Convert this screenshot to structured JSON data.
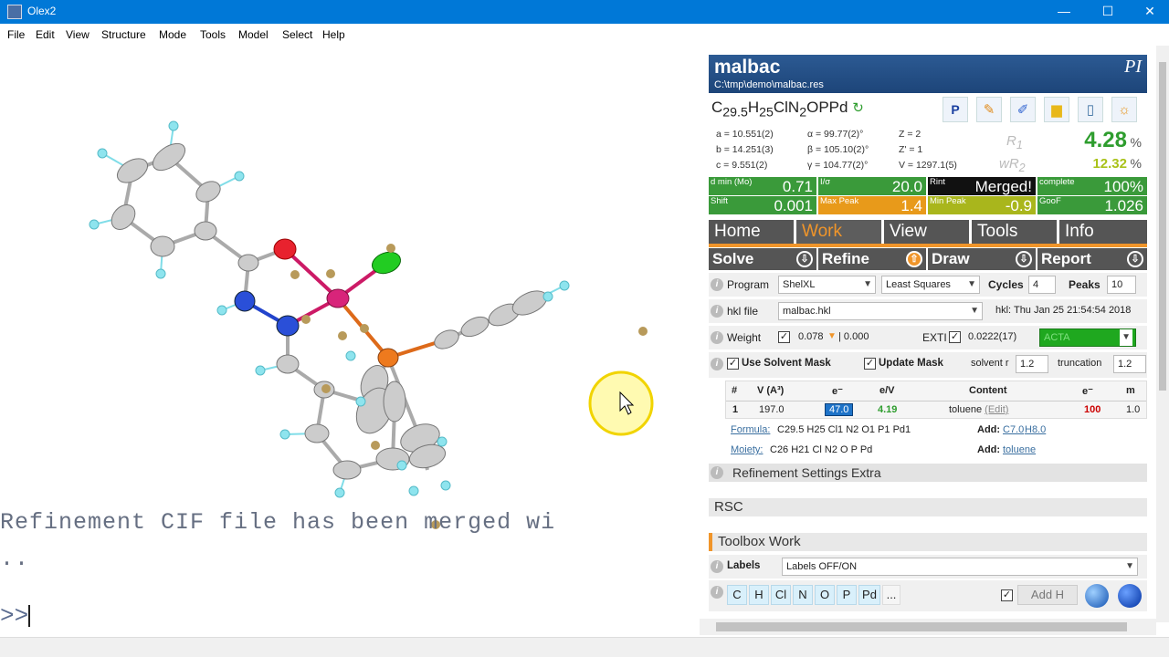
{
  "window": {
    "title": "Olex2",
    "minimize": "—",
    "maximize": "☐",
    "close": "✕"
  },
  "menu": [
    "File",
    "Edit",
    "View",
    "Structure",
    "Mode",
    "Tools",
    "Model",
    "Select",
    "Help"
  ],
  "console": {
    "line1": "Refinement CIF file has been merged wi",
    "line2": "..",
    "prompt": ">>"
  },
  "structure": {
    "name": "malbac",
    "path": "C:\\tmp\\demo\\malbac.res",
    "logo": "PI",
    "formula_html": "C<sub>29.5</sub>H<sub>25</sub>ClN<sub>2</sub>OPPd"
  },
  "cell": {
    "a": "a = 10.551(2)",
    "b": "b = 14.251(3)",
    "c": "c = 9.551(2)",
    "alpha": "α = 99.77(2)°",
    "beta": "β = 105.10(2)°",
    "gamma": "γ = 104.77(2)°",
    "Z": "Z = 2",
    "Zp": "Z' = 1",
    "V": "V = 1297.1(5)"
  },
  "r_values": {
    "R1_label": "R",
    "R1_sub": "1",
    "R1": "4.28",
    "wR2_label": "wR",
    "wR2_sub": "2",
    "wR2": "12.32",
    "unit": "%"
  },
  "stats": [
    {
      "label": "d min (Mo)",
      "value": "0.71",
      "color": "#3a9a3a"
    },
    {
      "label": "I/σ",
      "value": "20.0",
      "color": "#3a9a3a"
    },
    {
      "label": "Rint",
      "value": "Merged!",
      "color": "#111111"
    },
    {
      "label": "complete",
      "value": "100%",
      "color": "#3a9a3a"
    },
    {
      "label": "Shift",
      "value": "0.001",
      "color": "#3a9a3a"
    },
    {
      "label": "Max Peak",
      "value": "1.4",
      "color": "#e89a1a"
    },
    {
      "label": "Min Peak",
      "value": "-0.9",
      "color": "#a9b61c"
    },
    {
      "label": "GooF",
      "value": "1.026",
      "color": "#3a9a3a"
    }
  ],
  "tabs": [
    "Home",
    "Work",
    "View",
    "Tools",
    "Info"
  ],
  "subtabs": [
    "Solve",
    "Refine",
    "Draw",
    "Report"
  ],
  "refine": {
    "program_label": "Program",
    "program": "ShelXL",
    "method": "Least Squares",
    "cycles_label": "Cycles",
    "cycles": "4",
    "peaks_label": "Peaks",
    "peaks": "10",
    "hkl_label": "hkl file",
    "hkl_file": "malbac.hkl",
    "hkl_date": "hkl: Thu Jan 25 21:54:54 2018",
    "weight_label": "Weight",
    "weight": "0.078",
    "weight2": "| 0.000",
    "exti_label": "EXTI",
    "exti": "0.0222(17)",
    "acta": "ACTA",
    "solvent_mask_label": "Use Solvent Mask",
    "update_mask_label": "Update Mask",
    "solvent_r_label": "solvent r",
    "solvent_r": "1.2",
    "truncation_label": "truncation",
    "truncation": "1.2"
  },
  "mask_table": {
    "headers": [
      "#",
      "V (A³)",
      "e⁻",
      "e/V",
      "Content",
      "e⁻",
      "m"
    ],
    "row": [
      "1",
      "197.0",
      "47.0",
      "4.19",
      "toluene",
      "100",
      "1.0"
    ],
    "edit": "(Edit)"
  },
  "formula_row": {
    "label": "Formula:",
    "value": "C29.5 H25 Cl1 N2 O1 P1 Pd1",
    "add_label": "Add:",
    "add1": "C7.0",
    "add2": "H8.0"
  },
  "moiety_row": {
    "label": "Moiety:",
    "value": "C26 H21 Cl N2 O P Pd",
    "add_label": "Add:",
    "add": "toluene"
  },
  "sections": {
    "extra": "Refinement Settings Extra",
    "rsc": "RSC",
    "toolbox": "Toolbox Work"
  },
  "labels_row": {
    "label": "Labels",
    "value": "Labels OFF/ON"
  },
  "elements": [
    "C",
    "H",
    "Cl",
    "N",
    "O",
    "P",
    "Pd",
    "..."
  ],
  "add_h": "Add H"
}
